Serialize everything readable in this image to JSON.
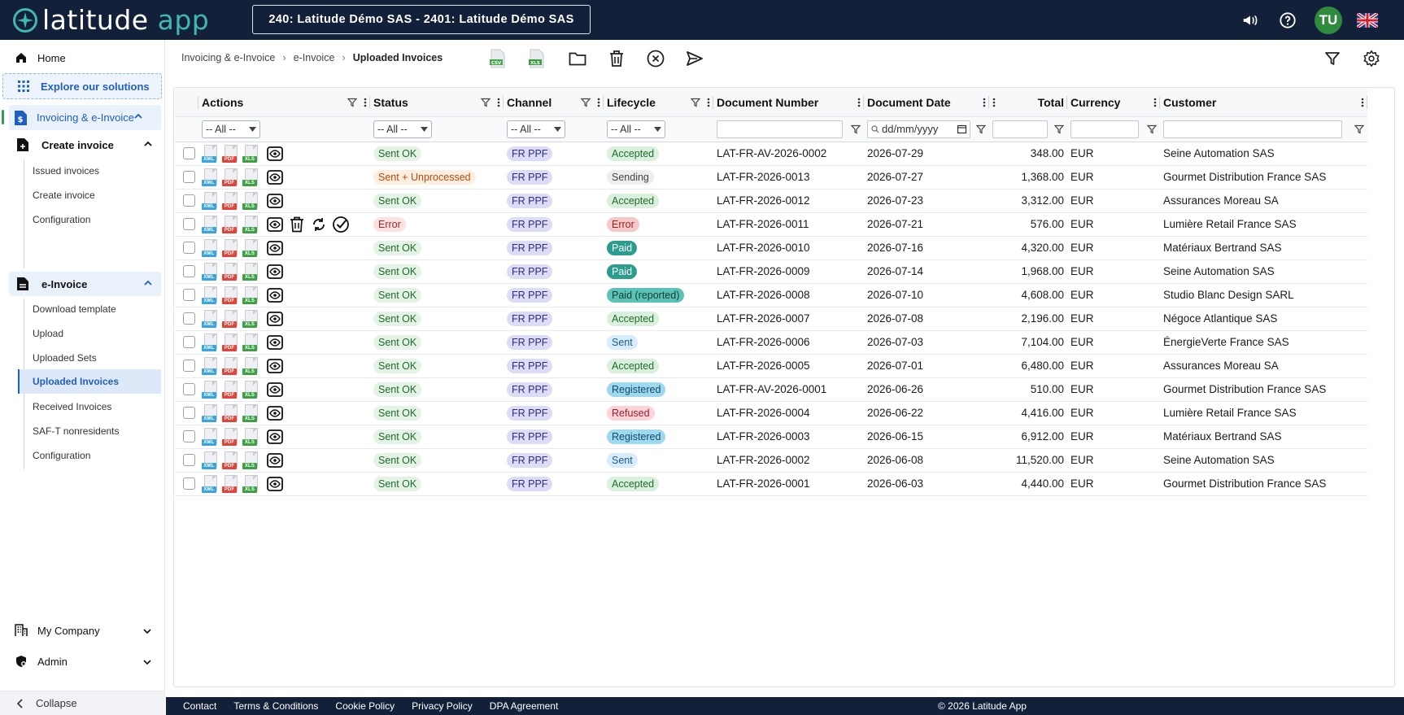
{
  "app": {
    "logo_text_1": "latitude",
    "logo_text_2": "app",
    "company_selector": "240: Latitude Démo SAS - 2401: Latitude Démo SAS",
    "avatar_initials": "TU"
  },
  "sidebar": {
    "home": "Home",
    "explore": "Explore our solutions",
    "invoicing": "Invoicing & e-Invoice",
    "create_invoice_group": "Create invoice",
    "create_items": [
      "Issued invoices",
      "Create invoice",
      "Configuration"
    ],
    "einvoice_group": "e-Invoice",
    "einvoice_items": [
      "Download template",
      "Upload",
      "Uploaded Sets",
      "Uploaded Invoices",
      "Received Invoices",
      "SAF-T nonresidents",
      "Configuration"
    ],
    "my_company": "My Company",
    "admin": "Admin",
    "collapse": "Collapse"
  },
  "breadcrumb": {
    "level1": "Invoicing & e-Invoice",
    "level2": "e-Invoice",
    "current": "Uploaded Invoices"
  },
  "toolbar_icons": [
    "csv-export-icon",
    "xls-export-icon",
    "folder-icon",
    "trash-icon",
    "cancel-circle-icon",
    "send-icon",
    "filter-icon",
    "settings-gear-icon"
  ],
  "table": {
    "headers": {
      "actions": "Actions",
      "status": "Status",
      "channel": "Channel",
      "lifecycle": "Lifecycle",
      "doc_number": "Document Number",
      "doc_date": "Document Date",
      "total": "Total",
      "currency": "Currency",
      "customer": "Customer"
    },
    "filters": {
      "status": "-- All --",
      "channel": "-- All --",
      "lifecycle": "-- All --",
      "actions": "-- All --",
      "date_placeholder": "dd/mm/yyyy"
    },
    "rows": [
      {
        "status": "Sent OK",
        "channel": "FR PPF",
        "lifecycle": "Accepted",
        "number": "LAT-FR-AV-2026-0002",
        "date": "2026-07-29",
        "total": "348.00",
        "currency": "EUR",
        "customer": "Seine Automation SAS"
      },
      {
        "status": "Sent + Unprocessed",
        "channel": "FR PPF",
        "lifecycle": "Sending",
        "number": "LAT-FR-2026-0013",
        "date": "2026-07-27",
        "total": "1,368.00",
        "currency": "EUR",
        "customer": "Gourmet Distribution France SAS"
      },
      {
        "status": "Sent OK",
        "channel": "FR PPF",
        "lifecycle": "Accepted",
        "number": "LAT-FR-2026-0012",
        "date": "2026-07-23",
        "total": "3,312.00",
        "currency": "EUR",
        "customer": "Assurances Moreau SA"
      },
      {
        "status": "Error",
        "channel": "FR PPF",
        "lifecycle": "Error",
        "number": "LAT-FR-2026-0011",
        "date": "2026-07-21",
        "total": "576.00",
        "currency": "EUR",
        "customer": "Lumière Retail France SAS"
      },
      {
        "status": "Sent OK",
        "channel": "FR PPF",
        "lifecycle": "Paid",
        "number": "LAT-FR-2026-0010",
        "date": "2026-07-16",
        "total": "4,320.00",
        "currency": "EUR",
        "customer": "Matériaux Bertrand SAS"
      },
      {
        "status": "Sent OK",
        "channel": "FR PPF",
        "lifecycle": "Paid",
        "number": "LAT-FR-2026-0009",
        "date": "2026-07-14",
        "total": "1,968.00",
        "currency": "EUR",
        "customer": "Seine Automation SAS"
      },
      {
        "status": "Sent OK",
        "channel": "FR PPF",
        "lifecycle": "Paid (reported)",
        "number": "LAT-FR-2026-0008",
        "date": "2026-07-10",
        "total": "4,608.00",
        "currency": "EUR",
        "customer": "Studio Blanc Design SARL"
      },
      {
        "status": "Sent OK",
        "channel": "FR PPF",
        "lifecycle": "Accepted",
        "number": "LAT-FR-2026-0007",
        "date": "2026-07-08",
        "total": "2,196.00",
        "currency": "EUR",
        "customer": "Négoce Atlantique SAS"
      },
      {
        "status": "Sent OK",
        "channel": "FR PPF",
        "lifecycle": "Sent",
        "number": "LAT-FR-2026-0006",
        "date": "2026-07-03",
        "total": "7,104.00",
        "currency": "EUR",
        "customer": "ÉnergieVerte France SAS"
      },
      {
        "status": "Sent OK",
        "channel": "FR PPF",
        "lifecycle": "Accepted",
        "number": "LAT-FR-2026-0005",
        "date": "2026-07-01",
        "total": "6,480.00",
        "currency": "EUR",
        "customer": "Assurances Moreau SA"
      },
      {
        "status": "Sent OK",
        "channel": "FR PPF",
        "lifecycle": "Registered",
        "number": "LAT-FR-AV-2026-0001",
        "date": "2026-06-26",
        "total": "510.00",
        "currency": "EUR",
        "customer": "Gourmet Distribution France SAS"
      },
      {
        "status": "Sent OK",
        "channel": "FR PPF",
        "lifecycle": "Refused",
        "number": "LAT-FR-2026-0004",
        "date": "2026-06-22",
        "total": "4,416.00",
        "currency": "EUR",
        "customer": "Lumière Retail France SAS"
      },
      {
        "status": "Sent OK",
        "channel": "FR PPF",
        "lifecycle": "Registered",
        "number": "LAT-FR-2026-0003",
        "date": "2026-06-15",
        "total": "6,912.00",
        "currency": "EUR",
        "customer": "Matériaux Bertrand SAS"
      },
      {
        "status": "Sent OK",
        "channel": "FR PPF",
        "lifecycle": "Sent",
        "number": "LAT-FR-2026-0002",
        "date": "2026-06-08",
        "total": "11,520.00",
        "currency": "EUR",
        "customer": "Seine Automation SAS"
      },
      {
        "status": "Sent OK",
        "channel": "FR PPF",
        "lifecycle": "Accepted",
        "number": "LAT-FR-2026-0001",
        "date": "2026-06-03",
        "total": "4,440.00",
        "currency": "EUR",
        "customer": "Gourmet Distribution France SAS"
      }
    ],
    "file_tags": [
      "XML",
      "PDF",
      "XLS"
    ]
  },
  "footer": {
    "links": [
      "Contact",
      "Terms & Conditions",
      "Cookie Policy",
      "Privacy Policy",
      "DPA Agreement"
    ],
    "copyright": "© 2026 Latitude App"
  },
  "colors": {
    "topbar_bg": "#13203a",
    "brand_teal": "#3fb8b0",
    "accent_blue": "#1f5fbf",
    "avatar_green": "#2e8b3d"
  }
}
